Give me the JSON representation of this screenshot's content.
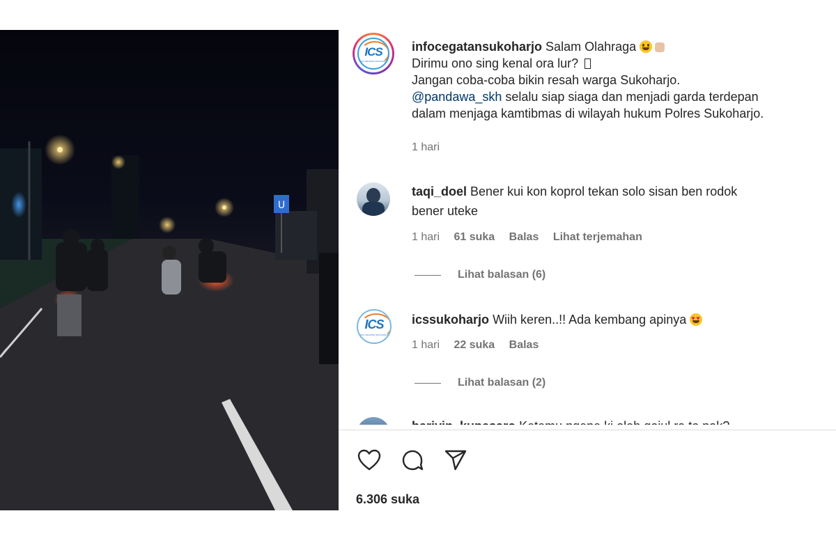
{
  "post": {
    "username": "infocegatansukoharjo",
    "caption_line1": "Salam Olahraga",
    "caption_line2": "Dirimu ono sing kenal ora lur?",
    "caption_line3": "Jangan coba-coba bikin resah warga Sukoharjo.",
    "mention": "@pandawa_skh",
    "caption_line4_rest": "selalu siap siaga dan menjadi garda terdepan",
    "caption_line5": "dalam menjaga kamtibmas di wilayah hukum Polres Sukoharjo.",
    "time": "1 hari",
    "logo_text": "ICS",
    "logo_sub": "INFO CEGATAN SUKOHARJO"
  },
  "comments": [
    {
      "username": "taqi_doel",
      "text_line1": "Bener kui kon koprol tekan solo sisan ben rodok",
      "text_line2": "bener uteke",
      "time": "1 hari",
      "likes": "61 suka",
      "reply": "Balas",
      "translate": "Lihat terjemahan",
      "view_replies": "Lihat balasan (6)"
    },
    {
      "username": "icssukoharjo",
      "text_line1": "Wiih keren..!! Ada kembang apinya",
      "time": "1 hari",
      "likes": "22 suka",
      "reply": "Balas",
      "view_replies": "Lihat balasan (2)"
    },
    {
      "username": "bariyin_kupesaro",
      "text_line1": "Ketemu ngene ki oleh gojul ra to pak?"
    }
  ],
  "actions": {
    "like_icon": "heart-icon",
    "comment_icon": "comment-bubble-icon",
    "share_icon": "paper-plane-icon"
  },
  "likes_count": "6.306 suka",
  "colors": {
    "text": "#262626",
    "muted": "#737373",
    "mention": "#00376b",
    "divider": "#dbdbdb"
  }
}
